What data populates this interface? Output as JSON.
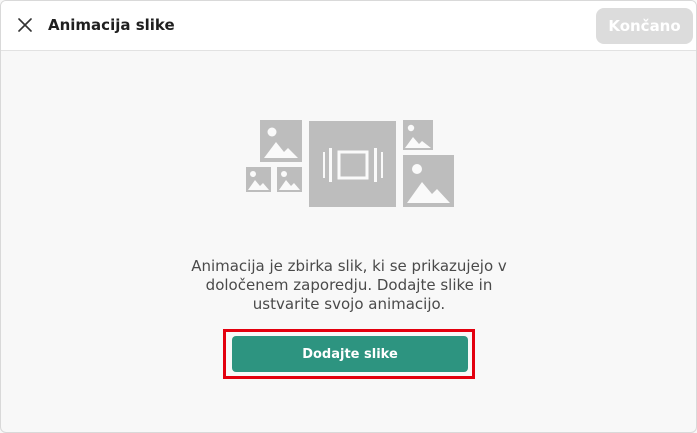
{
  "header": {
    "title": "Animacija slike",
    "close_icon": "close-icon",
    "done_label": "Končano"
  },
  "main": {
    "illustration_icon": "image-gallery-illustration",
    "description": "Animacija je zbirka slik, ki se prikazujejo v določenem zaporedju. Dodajte slike in ustvarite svojo animacijo.",
    "add_images_label": "Dodajte slike"
  },
  "colors": {
    "primary_button": "#2d9480",
    "disabled_button": "#dcdcdc",
    "highlight_border": "#e3000f",
    "illustration_gray": "#bdbdbd"
  }
}
